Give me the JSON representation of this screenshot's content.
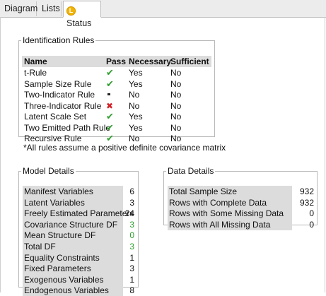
{
  "tabs": [
    {
      "label": "Diagram"
    },
    {
      "label": "Lists"
    },
    {
      "label": "Status",
      "icon": "L",
      "active": true
    }
  ],
  "identification": {
    "title": "Identification Rules",
    "headers": {
      "name": "Name",
      "pass": "Pass",
      "necessary": "Necessary",
      "sufficient": "Sufficient"
    },
    "rows": [
      {
        "name": "t-Rule",
        "pass": "check",
        "necessary": "Yes",
        "sufficient": "No"
      },
      {
        "name": "Sample Size Rule",
        "pass": "check",
        "necessary": "Yes",
        "sufficient": "No"
      },
      {
        "name": "Two-Indicator Rule",
        "pass": "dash",
        "necessary": "No",
        "sufficient": "No"
      },
      {
        "name": "Three-Indicator Rule",
        "pass": "cross",
        "necessary": "No",
        "sufficient": "No"
      },
      {
        "name": "Latent Scale Set",
        "pass": "check",
        "necessary": "Yes",
        "sufficient": "No"
      },
      {
        "name": "Two Emitted Path Rule",
        "pass": "check",
        "necessary": "Yes",
        "sufficient": "No"
      },
      {
        "name": "Recursive Rule",
        "pass": "check",
        "necessary": "No",
        "sufficient": "No"
      }
    ],
    "note": "*All rules assume a positive definite covariance matrix"
  },
  "model_details": {
    "title": "Model Details",
    "rows": [
      {
        "label": "Manifest Variables",
        "value": "6"
      },
      {
        "label": "Latent Variables",
        "value": "3"
      },
      {
        "label": "Freely Estimated Parameters",
        "value": "24"
      },
      {
        "label": "Covariance Structure DF",
        "value": "3",
        "color": "#2e9e2e"
      },
      {
        "label": "Mean Structure DF",
        "value": "0",
        "color": "#2e9e2e"
      },
      {
        "label": "Total DF",
        "value": "3",
        "color": "#2e9e2e"
      },
      {
        "label": "Equality Constraints",
        "value": "1"
      },
      {
        "label": "Fixed Parameters",
        "value": "3"
      },
      {
        "label": "Exogenous Variables",
        "value": "1"
      },
      {
        "label": "Endogenous Variables",
        "value": "8"
      }
    ]
  },
  "data_details": {
    "title": "Data Details",
    "rows": [
      {
        "label": "Total Sample Size",
        "value": "932"
      },
      {
        "label": "Rows with Complete Data",
        "value": "932"
      },
      {
        "label": "Rows with Some Missing Data",
        "value": "0"
      },
      {
        "label": "Rows with All Missing Data",
        "value": "0"
      }
    ]
  },
  "colors": {
    "pass": "#2e9e2e",
    "fail": "#d2232a",
    "header_bg": "#dcdcdc",
    "tab_icon": "#f2b400"
  }
}
